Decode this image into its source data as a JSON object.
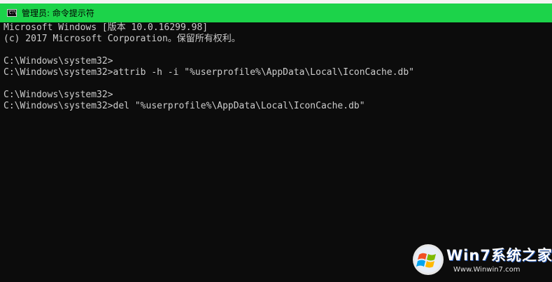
{
  "window": {
    "title": "管理员: 命令提示符",
    "titlebar_color": "#1cd34a",
    "console_bg": "#0c0c0c",
    "console_fg": "#cccccc"
  },
  "console": {
    "lines": [
      "Microsoft Windows [版本 10.0.16299.98]",
      "(c) 2017 Microsoft Corporation。保留所有权利。",
      "",
      "C:\\Windows\\system32>",
      "C:\\Windows\\system32>attrib -h -i \"%userprofile%\\AppData\\Local\\IconCache.db\"",
      "",
      "C:\\Windows\\system32>",
      "C:\\Windows\\system32>del \"%userprofile%\\AppData\\Local\\IconCache.db\""
    ]
  },
  "watermark": {
    "title": "Win7系统之家",
    "site": "Www.Winwin7.com",
    "logo_icon": "windows-flag-icon"
  }
}
